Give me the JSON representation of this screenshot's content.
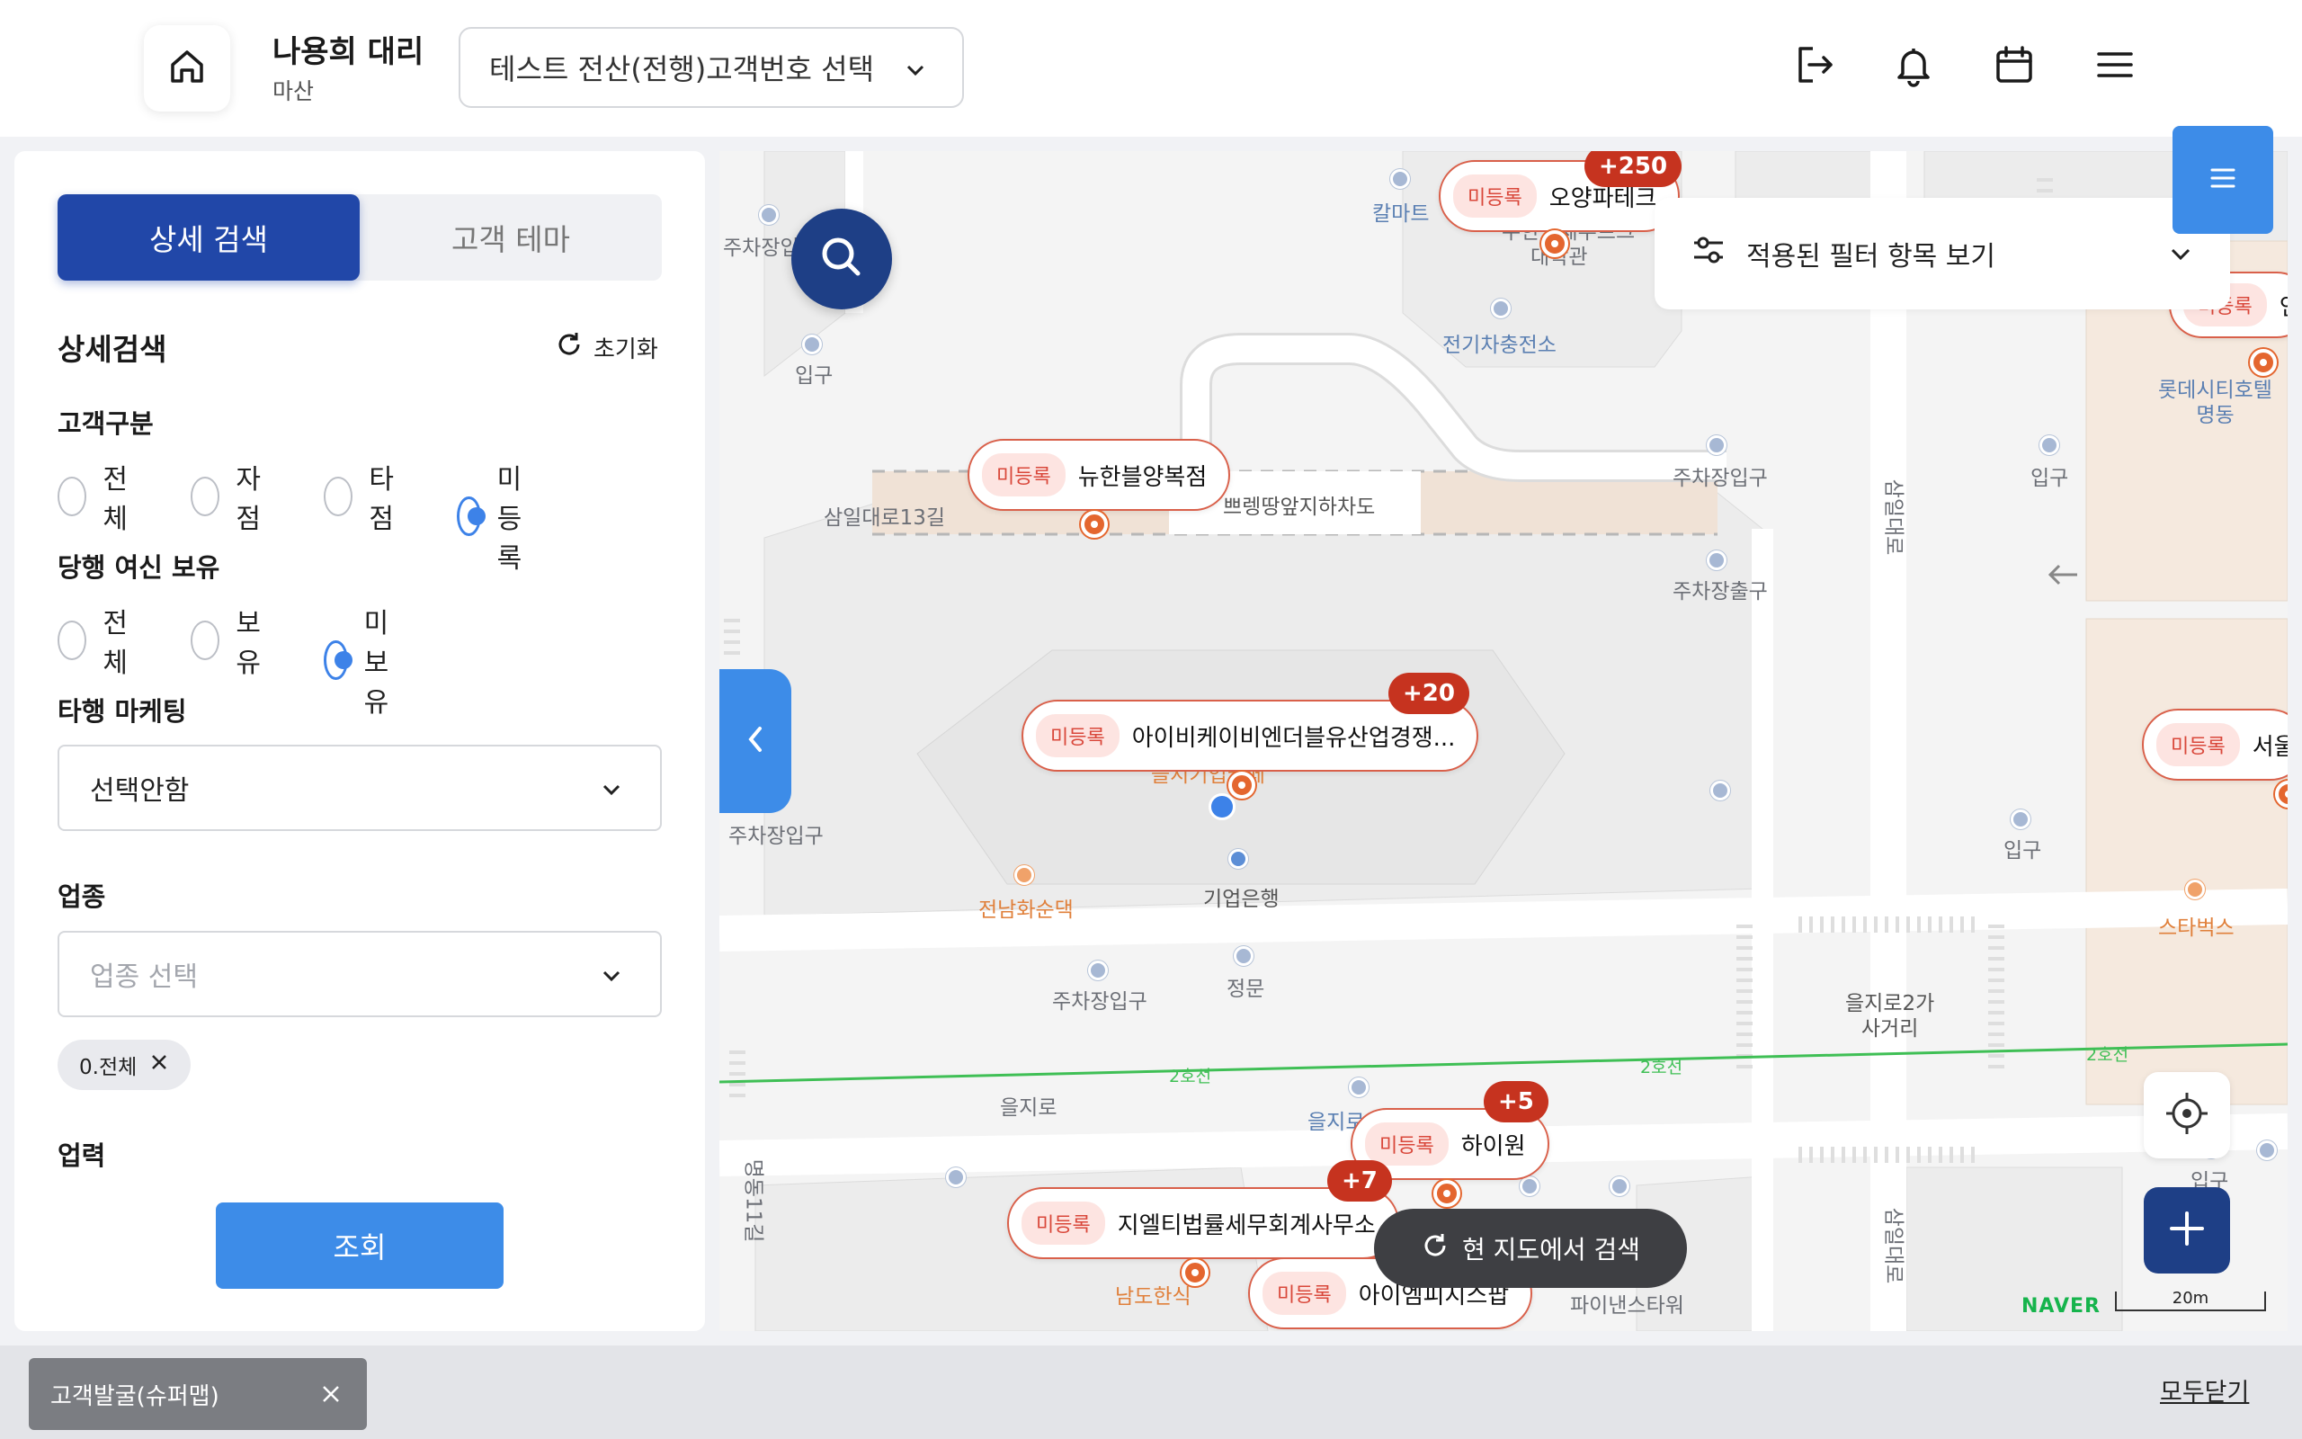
{
  "header": {
    "user_name": "나용희 대리",
    "user_branch": "마산",
    "customer_select": "테스트 전산(전행)고객번호 선택",
    "icons": [
      "home-icon",
      "logout-icon",
      "bell-icon",
      "calendar-icon",
      "menu-icon"
    ]
  },
  "panel": {
    "tabs": [
      {
        "label": "상세 검색",
        "active": true
      },
      {
        "label": "고객 테마",
        "active": false
      }
    ],
    "section_title": "상세검색",
    "reset_label": "초기화",
    "customer_type": {
      "label": "고객구분",
      "options": [
        "전체",
        "자점",
        "타점",
        "미등록"
      ],
      "selected": "미등록"
    },
    "credit": {
      "label": "당행 여신 보유",
      "options": [
        "전체",
        "보유",
        "미보유"
      ],
      "selected": "미보유"
    },
    "marketing": {
      "label": "타행 마케팅",
      "value": "선택안함"
    },
    "industry": {
      "label": "업종",
      "placeholder": "업종 선택",
      "chip": "0.전체"
    },
    "business_years_label": "업력",
    "search_button": "조회"
  },
  "map": {
    "filter_label": "적용된 필터 항목 보기",
    "here_search": "현 지도에서 검색",
    "naver": "NAVER",
    "scale": "20m",
    "markers": [
      {
        "tag": "미등록",
        "name": "오양파테크",
        "count": "+250"
      },
      {
        "tag": "미등록",
        "name": "뉴한블양복점",
        "count": ""
      },
      {
        "tag": "미등록",
        "name": "아이비케이비엔더블유산업경쟁...",
        "count": "+20"
      },
      {
        "tag": "미등록",
        "name": "하이원",
        "count": "+5"
      },
      {
        "tag": "미등록",
        "name": "지엘티법률세무회계사무소",
        "count": "+7"
      },
      {
        "tag": "미등록",
        "name": "아이엠피지스팝",
        "count": ""
      },
      {
        "tag": "미등록",
        "name": "서울",
        "count": ""
      },
      {
        "tag": "미등록",
        "name": "인",
        "count": ""
      }
    ],
    "labels": {
      "kalmart": "칼마트",
      "suhan": "수한동제부르크",
      "daehak": "대학관",
      "ev": "전기차충전소",
      "entrance1": "입구",
      "parking_entrance1": "주차장입",
      "samil13": "삼일대로13길",
      "underpass": "쁘렝땅앞지하차도",
      "parking_entrance2": "주차장입구",
      "parking_exit": "주차장출구",
      "samildaero": "삼일대로",
      "entrance2": "입구",
      "lotte": "롯데시티호텔\n명동",
      "eulji_cafe": "을지기업카페",
      "ibk": "기업은행",
      "jeonnam": "전남화순댁",
      "parking_entrance3": "주차장입구",
      "parking_entrance4": "주차장입구",
      "main_gate": "정문",
      "entrance3": "입구",
      "starbucks": "스타벅스",
      "euljiro2ga": "을지로2가\n사거리",
      "line2_a": "2호선",
      "line2_b": "2호선",
      "line2_c": "2호선",
      "euljiro": "을지로",
      "euljiro_station": "을지로입구",
      "myeongdong11": "명동11길",
      "namdo": "남도한식",
      "finance": "파이낸스타워",
      "entrance4": "입구",
      "samildaero2": "삼일대로"
    }
  },
  "bottom": {
    "tab_label": "고객발굴(슈퍼맵)",
    "close_all": "모두닫기"
  }
}
